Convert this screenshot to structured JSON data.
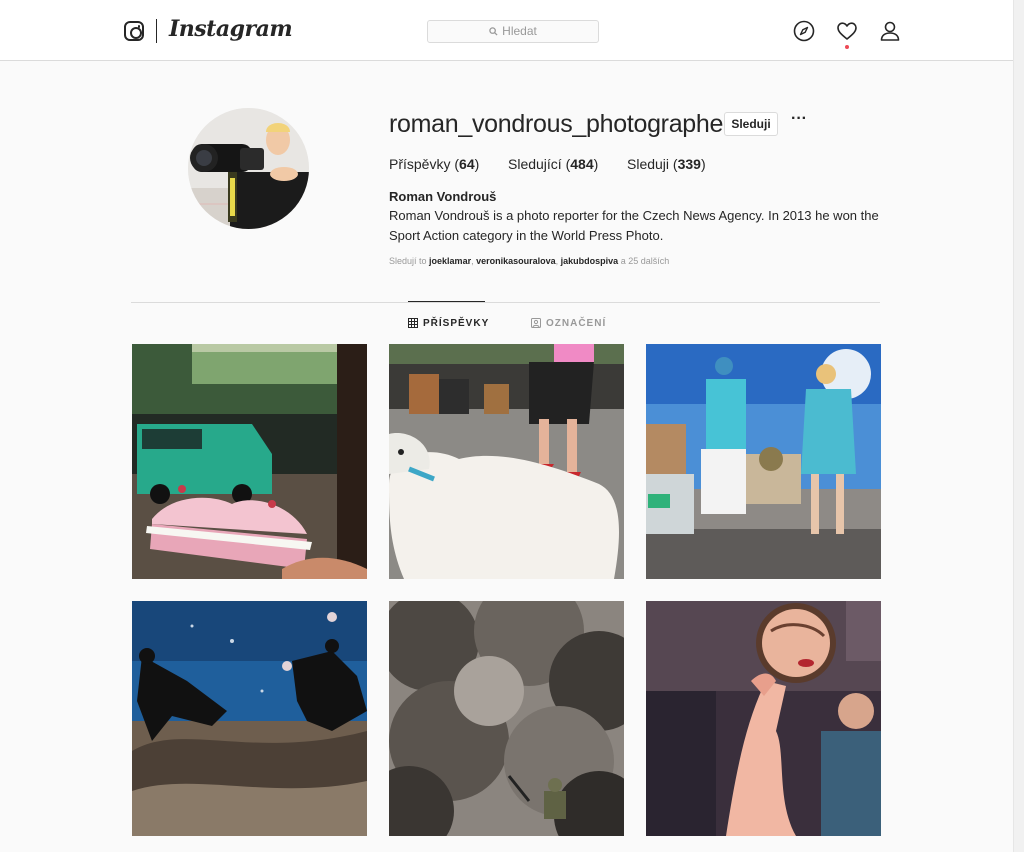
{
  "nav": {
    "wordmark": "Instagram",
    "search_placeholder": "Hledat",
    "icons": [
      "instagram-icon",
      "compass-icon",
      "heart-icon",
      "user-icon"
    ]
  },
  "profile": {
    "username": "roman_vondrous_photographer",
    "follow_label": "Sleduji",
    "more_label": "···",
    "stats": {
      "posts_label": "Příspěvky",
      "posts_count": "64",
      "followers_label": "Sledující",
      "followers_count": "484",
      "following_label": "Sleduji",
      "following_count": "339"
    },
    "full_name": "Roman Vondrouš",
    "bio": "Roman Vondrouš is a photo reporter for the Czech News Agency. In 2013 he won the Sport Action category in the World Press Photo.",
    "followed_by": {
      "prefix": "Sledují to",
      "users": [
        "joeklamar",
        "veronikasouralova",
        "jakubdospiva"
      ],
      "suffix": "a 25 dalších"
    }
  },
  "tabs": [
    {
      "label": "PŘÍSPĚVKY",
      "icon": "grid-icon",
      "active": true
    },
    {
      "label": "OZNAČENÍ",
      "icon": "tag-icon",
      "active": false
    }
  ],
  "posts": [
    {
      "name": "post-cake-car"
    },
    {
      "name": "post-dog-legs"
    },
    {
      "name": "post-stewardesses"
    },
    {
      "name": "post-horse-race"
    },
    {
      "name": "post-smoke-soldier"
    },
    {
      "name": "post-mirror-makeup"
    }
  ],
  "colors": {
    "text": "#262626",
    "muted": "#999999",
    "border": "#dbdbdb",
    "background": "#fafafa",
    "notification": "#ed4956"
  }
}
